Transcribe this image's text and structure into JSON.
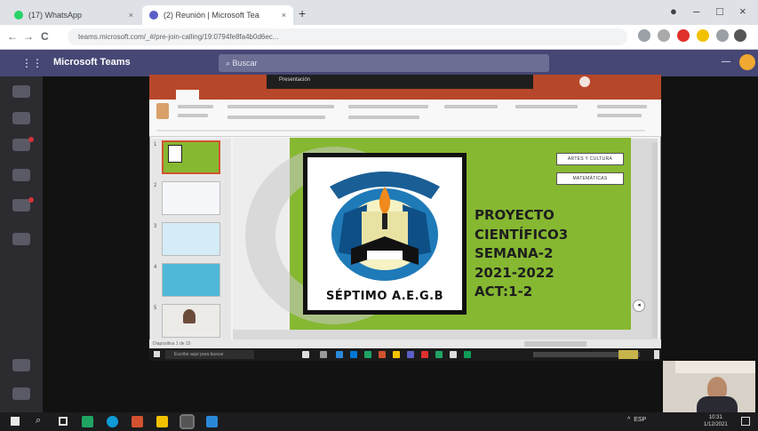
{
  "browser": {
    "tabs": [
      {
        "title": "(17) WhatsApp",
        "active": false,
        "favicon_color": "#25d366"
      },
      {
        "title": "(2) Reunión | Microsoft Tea",
        "active": true,
        "favicon_color": "#5b5fc7"
      }
    ],
    "address": "teams.microsoft.com/_#/pre-join-calling/19:0794fe8fa4b0d6ec...",
    "window_controls": {
      "minimize": "–",
      "maximize": "□",
      "close": "×"
    },
    "new_tab": "+",
    "nav": {
      "back": "←",
      "forward": "→",
      "reload": "C"
    }
  },
  "teams": {
    "app_title": "Microsoft Teams",
    "search_placeholder": "Buscar",
    "rail_items": [
      "Actividad",
      "Chat",
      "Equipos",
      "Tareas",
      "Calendario",
      "Llamadas"
    ],
    "accent": "#464775"
  },
  "powerpoint": {
    "title": "Presentación",
    "accent": "#b7472a",
    "thumb_numbers": [
      "1",
      "2",
      "3",
      "4",
      "5"
    ],
    "status_text": "Diapositiva 1 de 15",
    "taskbar_search": "Escribe aquí para buscar"
  },
  "slide": {
    "button_1": "ARTES Y CULTURA",
    "button_2": "MATEMÁTICAS",
    "logo_caption": "SÉPTIMO A.E.G.B",
    "lines": [
      "PROYECTO",
      "CIENTÍFICO3",
      "SEMANA-2",
      "2021-2022",
      "ACT:1-2"
    ],
    "nav_glyph": "◂",
    "background_color": "#86b832"
  },
  "windows_taskbar": {
    "time": "10:31",
    "date": "1/12/2021",
    "tray_text": "ESP"
  }
}
